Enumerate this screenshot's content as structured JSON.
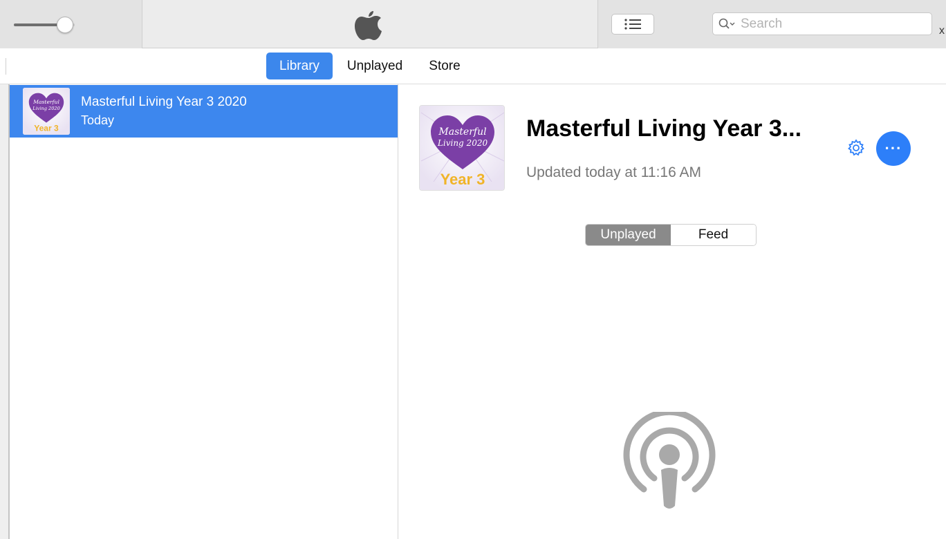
{
  "toolbar": {
    "volume_level": 0.7,
    "search": {
      "placeholder": "Search",
      "value": ""
    }
  },
  "tabs": [
    {
      "label": "Library",
      "active": true
    },
    {
      "label": "Unplayed",
      "active": false
    },
    {
      "label": "Store",
      "active": false
    }
  ],
  "sidebar": {
    "items": [
      {
        "title": "Masterful Living Year 3 2020",
        "subtitle": "Today",
        "selected": true
      }
    ]
  },
  "artwork": {
    "line1": "Masterful",
    "line2": "Living 2020",
    "year": "Year 3"
  },
  "detail": {
    "title": "Masterful Living Year 3...",
    "updated": "Updated today at 11:16 AM",
    "more_label": "···",
    "segments": [
      {
        "label": "Unplayed",
        "active": true
      },
      {
        "label": "Feed",
        "active": false
      }
    ]
  },
  "colors": {
    "accent": "#3c87ec",
    "more_button": "#2d7ff9",
    "heart": "#7b3fa6",
    "year_text": "#f0b429",
    "placeholder_icon": "#a9a9a9"
  }
}
